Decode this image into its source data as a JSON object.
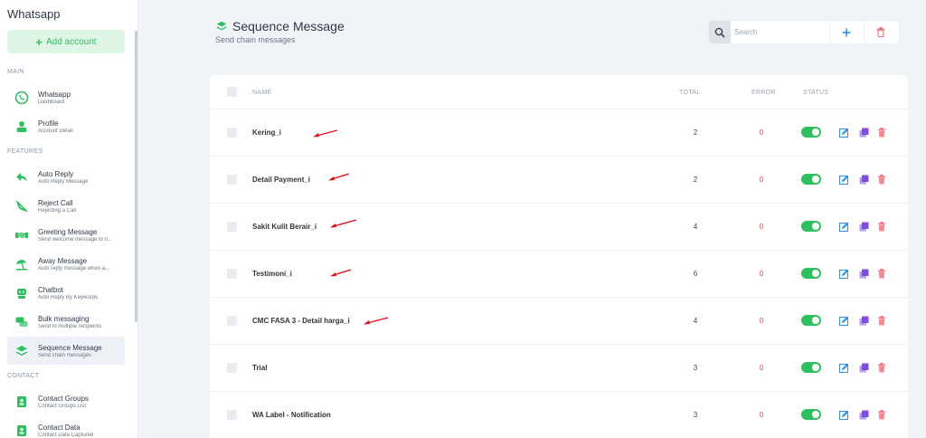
{
  "sidebar": {
    "title": "Whatsapp",
    "add_account": "Add account",
    "sections": {
      "main": "MAIN",
      "features": "FEATURES",
      "contact": "CONTACT"
    },
    "items": [
      {
        "label": "Whatsapp",
        "sub": "Dashboard",
        "icon": "whatsapp-icon"
      },
      {
        "label": "Profile",
        "sub": "Account Detail",
        "icon": "user-icon"
      },
      {
        "label": "Auto Reply",
        "sub": "Auto Reply Message",
        "icon": "reply-icon"
      },
      {
        "label": "Reject Call",
        "sub": "Rejecting a Call",
        "icon": "phone-off-icon"
      },
      {
        "label": "Greeting Message",
        "sub": "Send welcome message to n...",
        "icon": "handshake-icon"
      },
      {
        "label": "Away Message",
        "sub": "Auto reply message when a...",
        "icon": "beach-umbrella-icon"
      },
      {
        "label": "Chatbot",
        "sub": "Auto Reply By Keywords",
        "icon": "robot-icon"
      },
      {
        "label": "Bulk messaging",
        "sub": "Send to multiple recipients",
        "icon": "chat-bubbles-icon"
      },
      {
        "label": "Sequence Message",
        "sub": "Send chain messages",
        "icon": "layers-icon"
      },
      {
        "label": "Contact Groups",
        "sub": "Contact Groups List",
        "icon": "contact-book-icon"
      },
      {
        "label": "Contact Data",
        "sub": "Contact Data Captured",
        "icon": "contact-card-icon"
      }
    ]
  },
  "header": {
    "title": "Sequence Message",
    "subtitle": "Send chain messages"
  },
  "toolbar": {
    "search_placeholder": "Search"
  },
  "table": {
    "columns": {
      "name": "NAME",
      "total": "TOTAL",
      "error": "ERROR",
      "status": "STATUS"
    },
    "rows": [
      {
        "name": "Kering_i",
        "total": "2",
        "error": "0",
        "status": "on"
      },
      {
        "name": "Detail Payment_i",
        "total": "2",
        "error": "0",
        "status": "on"
      },
      {
        "name": "Sakit Kulit Berair_i",
        "total": "4",
        "error": "0",
        "status": "on"
      },
      {
        "name": "Testimoni_i",
        "total": "6",
        "error": "0",
        "status": "on"
      },
      {
        "name": "CMC FASA 3 - Detail harga_i",
        "total": "4",
        "error": "0",
        "status": "on"
      },
      {
        "name": "Trial",
        "total": "3",
        "error": "0",
        "status": "on"
      },
      {
        "name": "WA Label - Notification",
        "total": "3",
        "error": "0",
        "status": "on"
      }
    ]
  },
  "colors": {
    "accent_green": "#2fbf5f",
    "edit_blue": "#2f8fe6",
    "copy_purple": "#7b4fe0",
    "delete_red": "#f06b7a",
    "annotation_arrow": "#e0101c"
  }
}
